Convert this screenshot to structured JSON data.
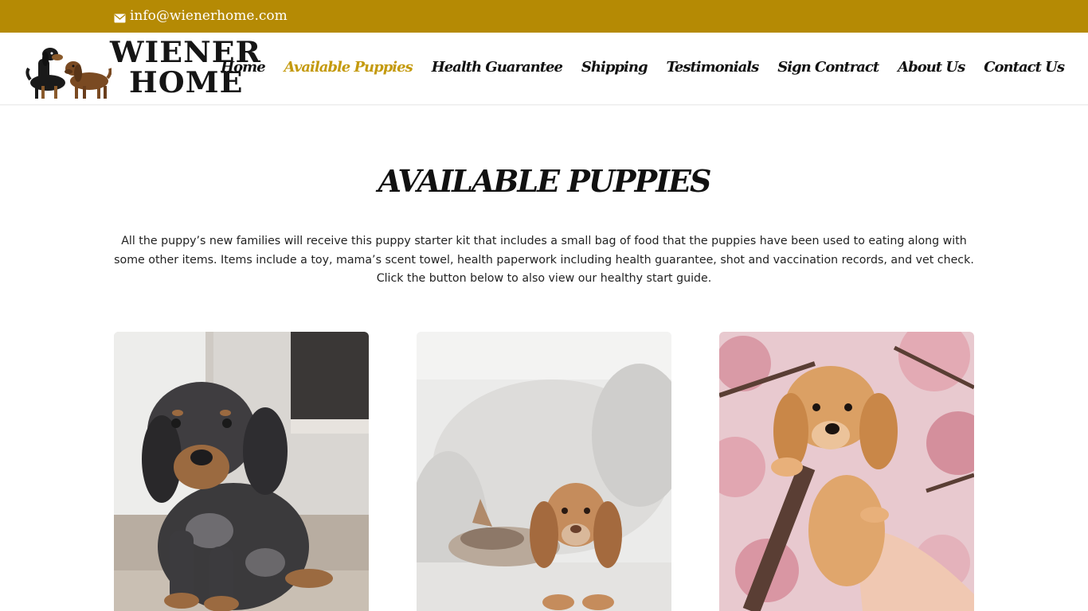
{
  "topbar": {
    "email": "info@wienerhome.com",
    "email_icon": "envelope-icon"
  },
  "logo": {
    "line1": "WIENER",
    "line2": "HOME"
  },
  "nav": {
    "items": [
      {
        "label": "Home"
      },
      {
        "label": "Available Puppies",
        "active": true
      },
      {
        "label": "Health Guarantee"
      },
      {
        "label": "Shipping"
      },
      {
        "label": "Testimonials"
      },
      {
        "label": "Sign Contract"
      },
      {
        "label": "About Us"
      },
      {
        "label": "Contact Us"
      }
    ]
  },
  "main": {
    "title": "AVAILABLE PUPPIES",
    "intro": "All the puppy’s new families will receive this puppy starter kit that includes a small bag of food that the puppies have been used to eating along with some other items. Items include a toy, mama’s scent towel, health paperwork including health guarantee, shot and vaccination records, and vet check. Click the button below to also view our healthy start guide."
  },
  "colors": {
    "topbar": "#b58a04",
    "accent": "#c49a0e",
    "text": "#111111"
  }
}
